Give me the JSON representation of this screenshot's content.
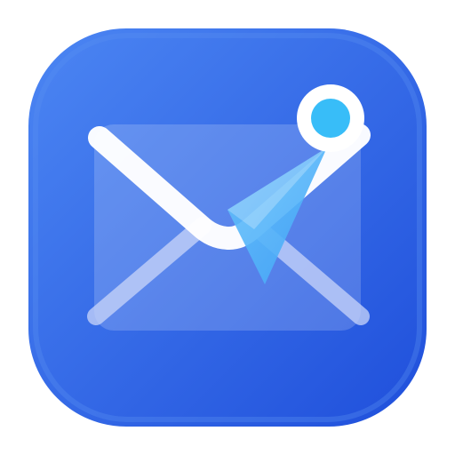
{
  "app_icon": {
    "icon_name": "mail-send-icon",
    "colors": {
      "tile_light": "#4c86f3",
      "tile_dark": "#1f4fdb",
      "tile_rim": "#5a8ff0",
      "envelope_body": "#ffffff",
      "envelope_lines": "#c9d6fa",
      "flap_stroke": "#ffffff",
      "paper_plane_light": "#67c2fb",
      "paper_plane_dark": "#41a6f7",
      "badge_ring": "#ffffff",
      "badge_dot": "#38bdf8"
    }
  }
}
